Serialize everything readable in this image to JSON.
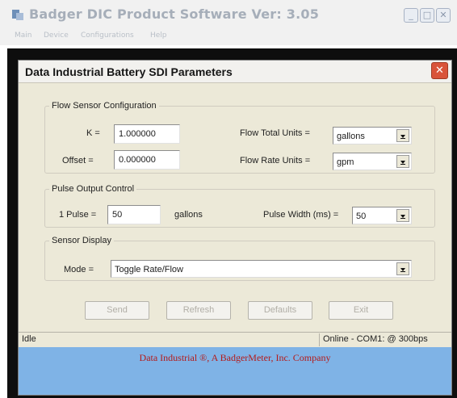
{
  "app": {
    "title": "Badger DIC Product Software Ver: 3.05",
    "menu": [
      "Main",
      "Device",
      "Configurations",
      "Help"
    ],
    "window_controls": {
      "minimize": "_",
      "maximize": "□",
      "close": "✕"
    }
  },
  "dialog": {
    "title": "Data Industrial Battery SDI Parameters",
    "close_glyph": "✕",
    "flow_sensor": {
      "legend": "Flow Sensor Configuration",
      "k_label": "K =",
      "k_value": "1.000000",
      "offset_label": "Offset =",
      "offset_value": "0.000000",
      "flow_total_units_label": "Flow Total Units =",
      "flow_total_units_value": "gallons",
      "flow_rate_units_label": "Flow Rate Units =",
      "flow_rate_units_value": "gpm"
    },
    "pulse_output": {
      "legend": "Pulse Output Control",
      "pulse_label": "1 Pulse =",
      "pulse_value": "50",
      "pulse_unit": "gallons",
      "pulse_width_label": "Pulse Width (ms) =",
      "pulse_width_value": "50"
    },
    "sensor_display": {
      "legend": "Sensor Display",
      "mode_label": "Mode =",
      "mode_value": "Toggle Rate/Flow"
    },
    "buttons": {
      "send": "Send",
      "refresh": "Refresh",
      "defaults": "Defaults",
      "exit": "Exit"
    },
    "status": {
      "left": "Idle",
      "right": "Online - COM1: @ 300bps"
    },
    "banner": "Data Industrial ®, A BadgerMeter, Inc. Company"
  },
  "colors": {
    "dialog_bg": "#ece9d8",
    "banner_bg": "#7fb3e6",
    "banner_text": "#b41b1b",
    "close_button": "#d9543a"
  }
}
